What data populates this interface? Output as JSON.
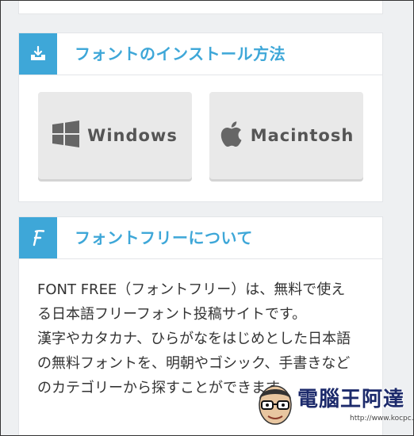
{
  "install_section": {
    "title": "フォントのインストール方法",
    "icon": "download-tray-icon",
    "buttons": [
      {
        "label": "Windows",
        "icon": "windows-logo-icon"
      },
      {
        "label": "Macintosh",
        "icon": "apple-logo-icon"
      }
    ]
  },
  "about_section": {
    "title": "フォントフリーについて",
    "icon": "letter-f-icon",
    "paragraphs": [
      "FONT FREE（フォントフリー）は、無料で使える日本語フリーフォント投稿サイトです。",
      "漢字やカタカナ、ひらがなをはじめとした日本語の無料フォントを、明朝やゴシック、手書きなどのカテゴリーから探すことができます"
    ]
  },
  "watermark": {
    "text": "電腦王阿達",
    "url": "http://www.kocpc.com.tw"
  },
  "colors": {
    "accent": "#3ea7d8",
    "page_bg": "#eef0f2",
    "button_bg": "#e9e9e9"
  }
}
